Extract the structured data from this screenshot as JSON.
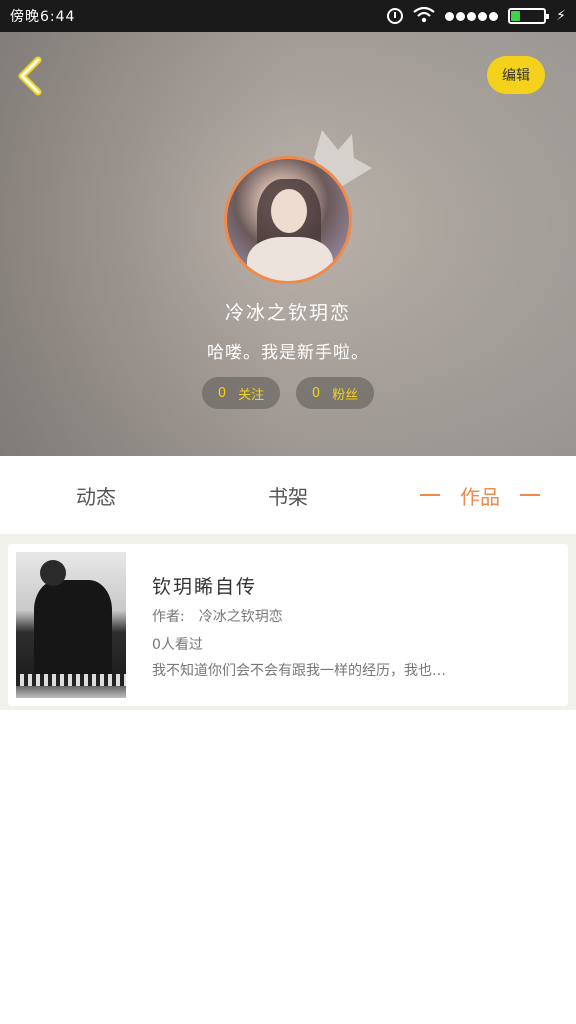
{
  "status_bar": {
    "time": "傍晚6:44"
  },
  "colors": {
    "accent_orange": "#f08a4b",
    "accent_yellow": "#f4d21c",
    "battery_green": "#3fd14a"
  },
  "header": {
    "back_icon": "chevron-left-icon",
    "edit_label": "编辑"
  },
  "profile": {
    "username": "冷冰之钦玥恋",
    "bio": "哈喽。我是新手啦。",
    "following_count": "0",
    "following_label": "关注",
    "fans_count": "0",
    "fans_label": "粉丝"
  },
  "tabs": [
    {
      "label": "动态"
    },
    {
      "label": "书架"
    },
    {
      "label": "作品"
    }
  ],
  "works": [
    {
      "title": "钦玥睎自传",
      "author_label": "作者:",
      "author": "冷冰之钦玥恋",
      "views": "0人看过",
      "description": "我不知道你们会不会有跟我一样的经历，我也…"
    }
  ]
}
